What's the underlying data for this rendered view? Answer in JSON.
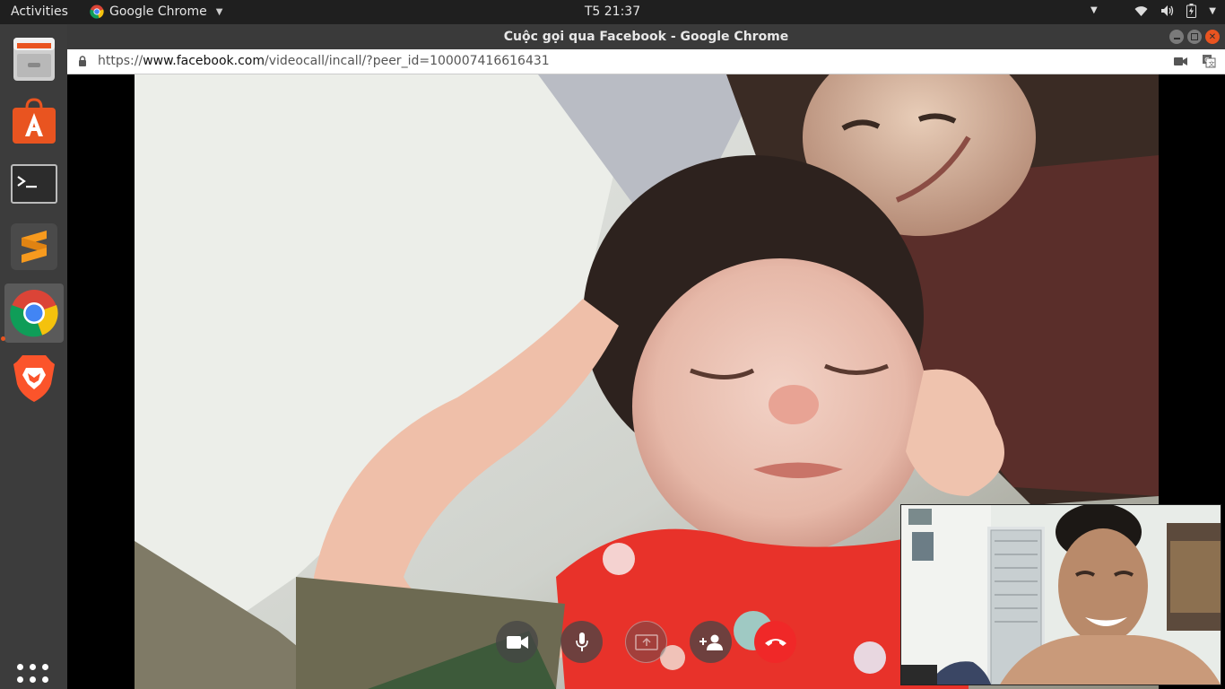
{
  "top_panel": {
    "activities": "Activities",
    "app_name": "Google Chrome",
    "clock": "T5 21:37"
  },
  "window": {
    "title": "Cuộc gọi qua Facebook - Google Chrome",
    "url_scheme": "https://",
    "url_host": "www.facebook.com",
    "url_path": "/videocall/incall/?peer_id=100007416616431"
  },
  "dock": {
    "items": [
      "files-icon",
      "software-center-icon",
      "terminal-icon",
      "sublime-text-icon",
      "chrome-icon",
      "brave-icon"
    ]
  },
  "call_controls": [
    "video-camera-icon",
    "microphone-icon",
    "screen-share-icon",
    "add-person-icon",
    "end-call-icon"
  ],
  "colors": {
    "end_call": "#f02828",
    "dock_bg": "#3c3c3c",
    "panel_bg": "#1f1f1f",
    "ubuntu_orange": "#e95420"
  }
}
